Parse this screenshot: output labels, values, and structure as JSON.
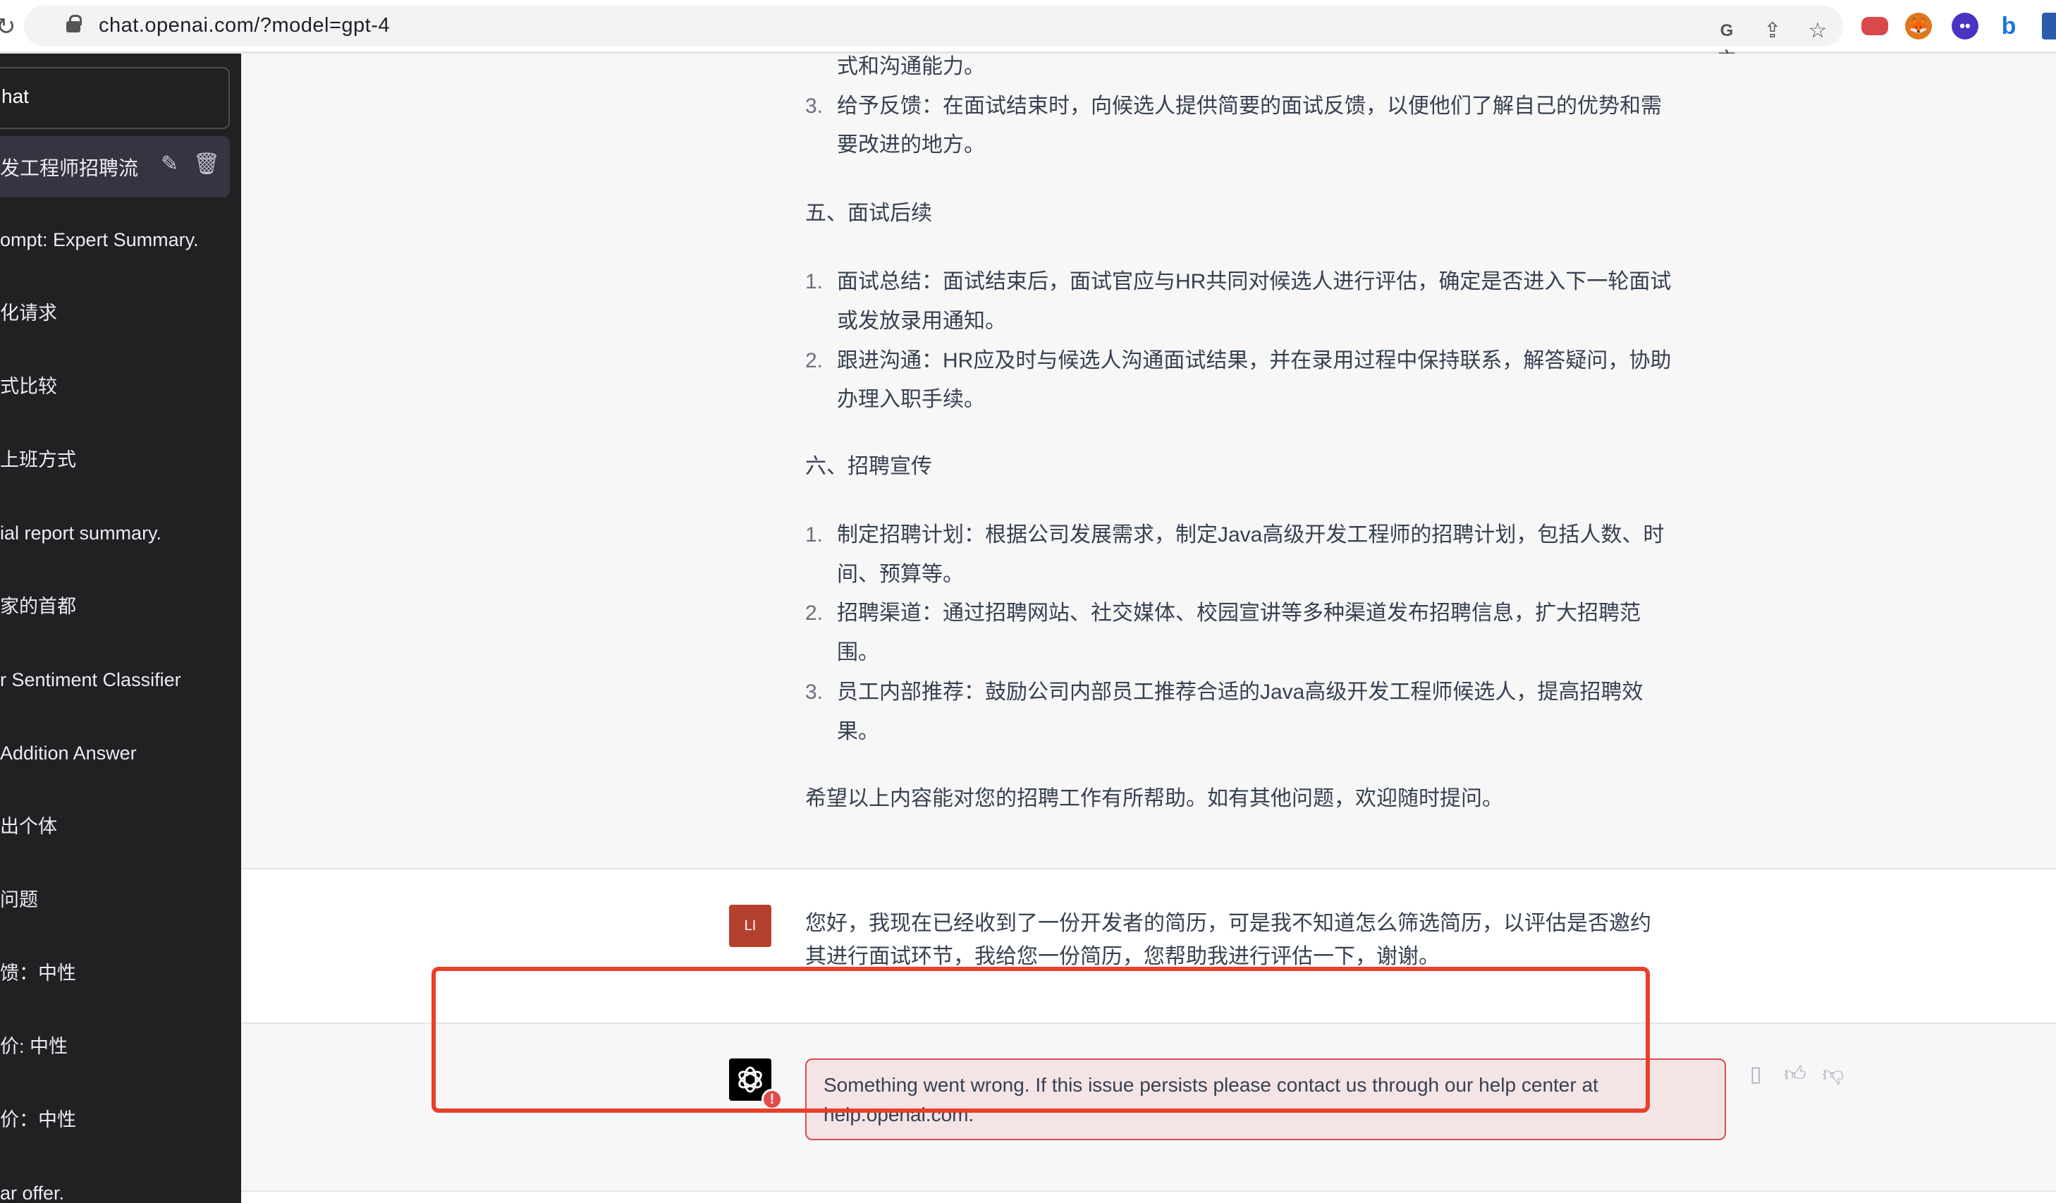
{
  "browser": {
    "url": "chat.openai.com/?model=gpt-4",
    "icons": [
      "reload-icon",
      "lock-icon",
      "translate-icon",
      "share-icon",
      "star-icon",
      "expressvpn-extension-icon",
      "metamask-extension-icon",
      "chat-extension-icon",
      "bing-extension-icon",
      "profile-extension-icon"
    ]
  },
  "sidebar": {
    "new_chat_label": "hat",
    "active_item": "发工程师招聘流",
    "items": [
      "ompt: Expert Summary.",
      "化请求",
      "式比较",
      "上班方式",
      "ial report summary.",
      "家的首都",
      "r Sentiment Classifier",
      "Addition Answer",
      "出个体",
      "问题",
      "馈：中性",
      "价: 中性",
      "价：中性",
      "ar offer."
    ]
  },
  "assistant_message": {
    "lines": [
      {
        "num": "",
        "text": "式和沟通能力。"
      },
      {
        "num": "3.",
        "text": "给予反馈：在面试结束时，向候选人提供简要的面试反馈，以便他们了解自己的优势和需"
      },
      {
        "num": "",
        "text": "要改进的地方。"
      },
      {
        "num": "",
        "text": "五、面试后续",
        "heading": true
      },
      {
        "num": "1.",
        "text": "面试总结：面试结束后，面试官应与HR共同对候选人进行评估，确定是否进入下一轮面试"
      },
      {
        "num": "",
        "text": "或发放录用通知。"
      },
      {
        "num": "2.",
        "text": "跟进沟通：HR应及时与候选人沟通面试结果，并在录用过程中保持联系，解答疑问，协助"
      },
      {
        "num": "",
        "text": "办理入职手续。"
      },
      {
        "num": "",
        "text": "六、招聘宣传",
        "heading": true
      },
      {
        "num": "1.",
        "text": "制定招聘计划：根据公司发展需求，制定Java高级开发工程师的招聘计划，包括人数、时"
      },
      {
        "num": "",
        "text": "间、预算等。"
      },
      {
        "num": "2.",
        "text": "招聘渠道：通过招聘网站、社交媒体、校园宣讲等多种渠道发布招聘信息，扩大招聘范"
      },
      {
        "num": "",
        "text": "围。"
      },
      {
        "num": "3.",
        "text": "员工内部推荐：鼓励公司内部员工推荐合适的Java高级开发工程师候选人，提高招聘效"
      },
      {
        "num": "",
        "text": "果。"
      },
      {
        "num": "",
        "text": "希望以上内容能对您的招聘工作有所帮助。如有其他问题，欢迎随时提问。",
        "heading": true
      }
    ]
  },
  "user_message": {
    "avatar_initials": "LI",
    "lines": [
      "您好，我现在已经收到了一份开发者的简历，可是我不知道怎么筛选简历，以评估是否邀约",
      "其进行面试环节，我给您一份简历，您帮助我进行评估一下，谢谢。"
    ]
  },
  "error_message": {
    "lines": [
      "Something went wrong. If this issue persists please contact us through our help center at",
      "help.openai.com."
    ],
    "badge": "!",
    "actions": [
      "copy-icon",
      "thumbs-up-icon",
      "thumbs-down-icon"
    ]
  },
  "colors": {
    "sidebar_bg": "#202123",
    "highlight": "#e8402a",
    "error_border": "#dc4d4d",
    "error_bg": "#f4e4e6",
    "user_avatar": "#b4412e"
  }
}
